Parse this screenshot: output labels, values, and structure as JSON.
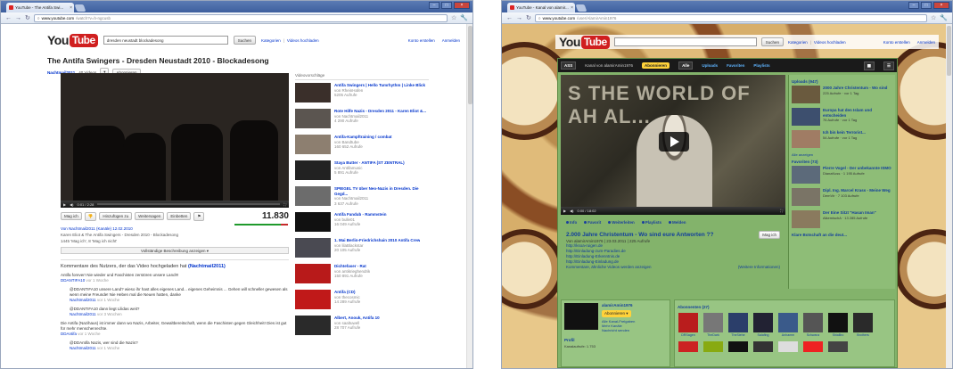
{
  "left": {
    "tab_title": "YouTube - The Antifa Swi...",
    "url_domain": "www.youtube.com",
    "url_path": "/watch?v=h-ngcusb",
    "search_value": "dresden neustadt blockadesong",
    "search_button": "Suchen",
    "header_links": [
      "Kategorien",
      "|",
      "Videos hochladen"
    ],
    "header_right": [
      "Konto erstellen",
      "Anmelden"
    ],
    "video_title": "The Antifa Swingers - Dresden Neustadt 2010 - Blockadesong",
    "channel": "Nachtmail2011",
    "channel_videos": "40 Videos",
    "subscribe_button": "Abonnieren",
    "player_time": "0:01 / 2:28",
    "like_button": "Mag ich",
    "add_button": "Hinzufügen zu",
    "share_button": "Weitersagen",
    "embed_button": "Einbetten",
    "views": "11.830",
    "upload_line": "Von Nachtmail2011 (Kanäle) 12.02.2010",
    "desc_line": "Karen Eliot & The Antifa Swingers - Dresden 2010 - Blockadesong",
    "rating_line": "1445 'Mag ich', 8 'Mag ich nicht'",
    "show_more": "Vollständige Beschreibung anzeigen ▾",
    "comments_head": "Kommentare des Nutzers, der das Video hochgeladen hat",
    "comments_head_user": "(Nachtmail2011)",
    "comments": [
      {
        "text": "Antifa forever! Nie wieder und Faschisten zerstören unsere Land!!!",
        "by": "DDANTIFA10",
        "time": "vor 1 Woche"
      },
      {
        "text": "@DDANTIFA10 unsere Land? wieso ihr hast alles eigenes Land... eigenes Geheimnis ... Gehen will schneller gewesen als wenn meine Freunde! Nie Heben mal die Neuen hatten, danke",
        "by": "Nachtmail2011",
        "time": "vor 1 Woche"
      },
      {
        "text": "@DDANTIFA10 dann liegt Lilidas weit?",
        "by": "Nachtmail2011",
        "time": "vor 3 Wochen"
      },
      {
        "text": "Die Antifa (Nazihaus) ist immer dann wo Nazis, Arbeiter, Gewaltbereitschaft, wenn die Faschisten gegen Gleichheit! Dies ist gut für mehr menschenrechte.",
        "by": "DDAntifa",
        "time": "vor 1 Woche"
      },
      {
        "text": "@DDAntifa Nazis, wer sind die Nazis?",
        "by": "Nachtmail2011",
        "time": "vor 1 Woche"
      }
    ],
    "sidebar_head": "Videovorschläge",
    "related": [
      {
        "title": "Antifa Swingers | Hello Tumrhythm | Linke Blick",
        "sub": "von RheinHafen",
        "views": "5205 Aufrufe"
      },
      {
        "title": "Rote Hilfe Nazis - Dresden 2011 - Karen Eliot &...",
        "sub": "von Nachtmail2011",
        "views": "4 290 Aufrufe"
      },
      {
        "title": "Antifa-Kampftraining / combat",
        "sub": "von Bandtube",
        "views": "160 652 Aufrufe"
      },
      {
        "title": "Staya Butter - ANTIFA (ST ZENTRAL)",
        "sub": "von Antifamusic",
        "views": "5 891 Aufrufe"
      },
      {
        "title": "SPIEGEL TV über Neo-Nazis in Dresden. Die Gegd...",
        "sub": "von Nachtmail2011",
        "views": "3 637 Aufrufe"
      },
      {
        "title": "Antifa Fandub - Rammstein",
        "sub": "von bulle01",
        "views": "16 049 Aufrufe"
      },
      {
        "title": "1. Mai Berlin-Friedrichshain 2010 Antifa Crew",
        "sub": "von lilaBlackstar",
        "views": "20 105 Aufrufe"
      },
      {
        "title": "Dichtefaser - Rat",
        "sub": "von antikrieghendrik",
        "views": "150 891 Aufrufe"
      },
      {
        "title": "Antifa (CD)",
        "sub": "von thecosmic",
        "views": "14 289 Aufrufe"
      },
      {
        "title": "Albert, Anouk, Antifa 10",
        "sub": "von saaltuwell",
        "views": "28 707 Aufrufe"
      }
    ]
  },
  "right": {
    "tab_title": "YouTube - Kanal von alamir...",
    "url_domain": "www.youtube.com",
    "url_path": "/user/AlamirAmin1976",
    "search_button": "Suchen",
    "header_links": [
      "Kategorien",
      "|",
      "Videos hochladen"
    ],
    "header_right": [
      "Konto erstellen",
      "Anmelden"
    ],
    "channel_name": "Kanal von alamirAmin1976",
    "subscribe_button": "Abonnieren",
    "all_button": "Alle",
    "nav": [
      "Uploads",
      "Favoriten",
      "Playlists"
    ],
    "video_wall_text": "S THE WORLD OF AH AL...",
    "player_time": "0:00 / 18:02",
    "tabs": [
      "Info",
      "Favorit",
      "Weiterleiten",
      "Playlists",
      "Melden"
    ],
    "video_title": "2.000 Jahre Christentum - Wo sind eure Antworten ??",
    "video_meta": "Von alamirAmin1976 | 23.03.2011 | 225 Aufrufe",
    "like_button": "Mag ich",
    "links": [
      "http://ksoa-ruigen.de",
      "http://Einladung-zum-Paradies.de",
      "http://Einladung-Erkenntnis.de",
      "http://Einladung-Einladung.de"
    ],
    "more_info": "(Weitere Informationen)",
    "comments_link": "Kommentare, ähnliche Videos werden anzeigen",
    "uploads_head": "Uploads (947)",
    "uploads": [
      {
        "title": "2000 Jahre Christentum - Wo sind",
        "sub": "225 Aufrufe · vor 1 Tag"
      },
      {
        "title": "Europa hat den Islam und entscheiden",
        "sub": "76 Aufrufe · vor 1 Tag"
      },
      {
        "title": "Ich bin kein Terrorist...",
        "sub": "54 Aufrufe · vor 1 Tag"
      }
    ],
    "all_link": "Alle anzeigen",
    "favs_head": "Favoriten (73)",
    "favs": [
      {
        "title": "Pierre Vogel - Der unbekannte ISMO",
        "sub": "DianaKuss · 1 195 Aufrufe"
      },
      {
        "title": "Dipl. Ing. Marcel Krass - Meine Weg",
        "sub": "DemVir · 7 103 Aufrufe"
      },
      {
        "title": "Der Eine Sitzt \"Hasan Iman\"",
        "sub": "AlkemischA · 13 285 Aufrufe"
      }
    ],
    "bottom_link": "Klare Botschaft an die deut...",
    "profile_name": "alamirAmin1976",
    "profile_sub_button": "Abonnieren ▾",
    "profile_lines": [
      "Alle Kanal-Freigaben",
      "Mehr Kanäle",
      "Nachricht senden"
    ],
    "profile_head": "Profil",
    "profile_stat": "Kanalaufrufe: 1.753",
    "subs_head": "Abonnenten (27)",
    "subs": [
      "DRSagen",
      "TheDark",
      "TheSiehe",
      "Salafing",
      "Anhamm",
      "Schwanz",
      "ShiaBro",
      "Brothers"
    ]
  }
}
